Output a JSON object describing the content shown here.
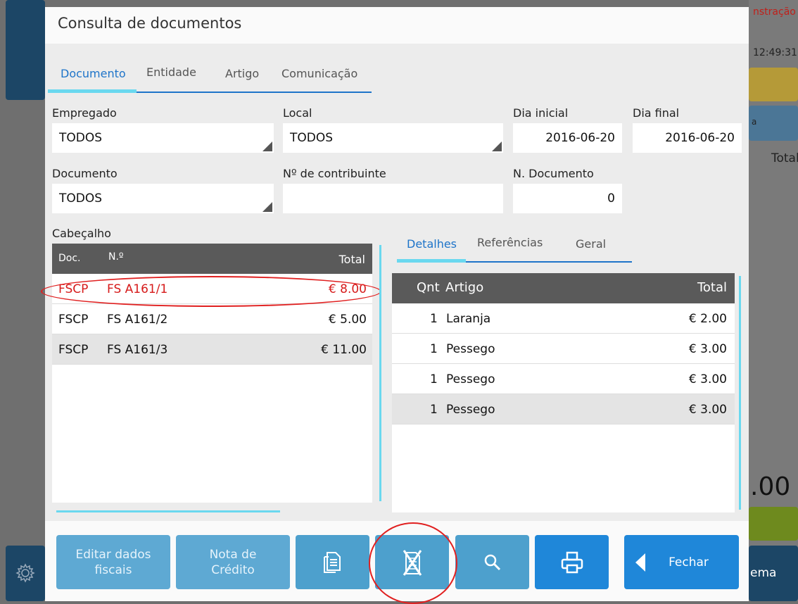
{
  "background": {
    "right_top_text": "nstração",
    "right_time": "12:49:31",
    "right_small": "a",
    "right_total": "Total",
    "right_big": ".00",
    "right_bottom": "ema"
  },
  "dialog": {
    "title": "Consulta de documentos"
  },
  "top_tabs": [
    {
      "label": "Documento"
    },
    {
      "label": "Entidade"
    },
    {
      "label": "Artigo"
    },
    {
      "label": "Comunicação"
    }
  ],
  "filters": {
    "empregado": {
      "label": "Empregado",
      "value": "TODOS"
    },
    "local": {
      "label": "Local",
      "value": "TODOS"
    },
    "dia_inicial": {
      "label": "Dia inicial",
      "value": "2016-06-20"
    },
    "dia_final": {
      "label": "Dia final",
      "value": "2016-06-20"
    },
    "documento": {
      "label": "Documento",
      "value": "TODOS"
    },
    "contribuinte": {
      "label": "Nº de contribuinte",
      "value": ""
    },
    "n_documento": {
      "label": "N. Documento",
      "value": "0"
    }
  },
  "header_list": {
    "label": "Cabeçalho",
    "columns": {
      "doc": "Doc.",
      "num": "N.º",
      "total": "Total"
    },
    "rows": [
      {
        "doc": "FSCP",
        "num": "FS A161/1",
        "total": "€ 8.00"
      },
      {
        "doc": "FSCP",
        "num": "FS A161/2",
        "total": "€ 5.00"
      },
      {
        "doc": "FSCP",
        "num": "FS A161/3",
        "total": "€ 11.00"
      }
    ]
  },
  "detail_tabs": [
    {
      "label": "Detalhes"
    },
    {
      "label": "Referências"
    },
    {
      "label": "Geral"
    }
  ],
  "detail_list": {
    "columns": {
      "qnt": "Qnt",
      "artigo": "Artigo",
      "total": "Total"
    },
    "rows": [
      {
        "qnt": "1",
        "artigo": "Laranja",
        "total": "€ 2.00"
      },
      {
        "qnt": "1",
        "artigo": "Pessego",
        "total": "€ 3.00"
      },
      {
        "qnt": "1",
        "artigo": "Pessego",
        "total": "€ 3.00"
      },
      {
        "qnt": "1",
        "artigo": "Pessego",
        "total": "€ 3.00"
      }
    ]
  },
  "footer": {
    "editar_line1": "Editar dados",
    "editar_line2": "fiscais",
    "nota_line1": "Nota de",
    "nota_line2": "Crédito",
    "fechar": "Fechar",
    "icons": {
      "document": "document-icon",
      "cancel_document": "cancel-document-icon",
      "search": "search-icon",
      "print": "printer-icon",
      "back": "triangle-left-icon",
      "settings": "gear-icon"
    }
  },
  "colors": {
    "accent": "#1e74c9",
    "tab_indicator": "#6ad8ef",
    "highlight_red": "#d61a1a",
    "header_bar": "#5a5a5a",
    "button_strong": "#1f87d9",
    "button_light": "#5ea9d3"
  }
}
